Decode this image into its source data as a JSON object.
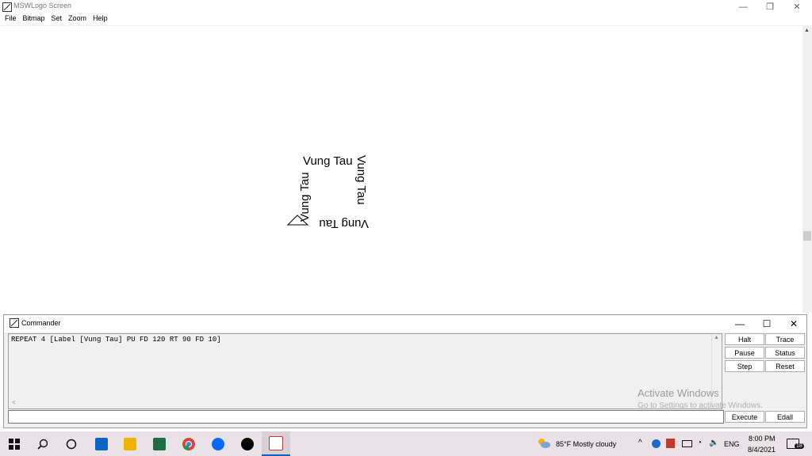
{
  "window": {
    "title": "MSWLogo Screen",
    "minimize": "—",
    "restore": "❐",
    "close": "✕"
  },
  "menu": [
    "File",
    "Bitmap",
    "Set",
    "Zoom",
    "Help"
  ],
  "canvas": {
    "label_text": "Vung Tau"
  },
  "commander": {
    "title": "Commander",
    "minimize": "—",
    "maximize": "☐",
    "close": "✕",
    "history_text": "REPEAT 4 [Label [Vung Tau] PU FD 120 RT 90 FD 10]",
    "input_value": "",
    "buttons": {
      "halt": "Halt",
      "trace": "Trace",
      "pause": "Pause",
      "status": "Status",
      "step": "Step",
      "reset": "Reset",
      "execute": "Execute",
      "edall": "Edall"
    }
  },
  "watermark": {
    "line1": "Activate Windows",
    "line2": "Go to Settings to activate Windows."
  },
  "taskbar": {
    "weather": "85°F  Mostly cloudy",
    "language": "ENG",
    "time": "8:00 PM",
    "date": "8/4/2021",
    "notifications": "18",
    "apps": [
      {
        "name": "start-icon",
        "color": "#000000"
      },
      {
        "name": "search-icon",
        "color": "#000000"
      },
      {
        "name": "cortana-icon",
        "color": "#000000"
      },
      {
        "name": "mail-icon",
        "color": "#0a64c8"
      },
      {
        "name": "file-explorer-icon",
        "color": "#f0b400"
      },
      {
        "name": "excel-icon",
        "color": "#1d6f42"
      },
      {
        "name": "chrome-icon",
        "color": "#db4437"
      },
      {
        "name": "zalo-icon",
        "color": "#0a68ff"
      },
      {
        "name": "tiktok-icon",
        "color": "#000000"
      },
      {
        "name": "mswlogo-icon",
        "color": "#c0392b"
      }
    ]
  }
}
